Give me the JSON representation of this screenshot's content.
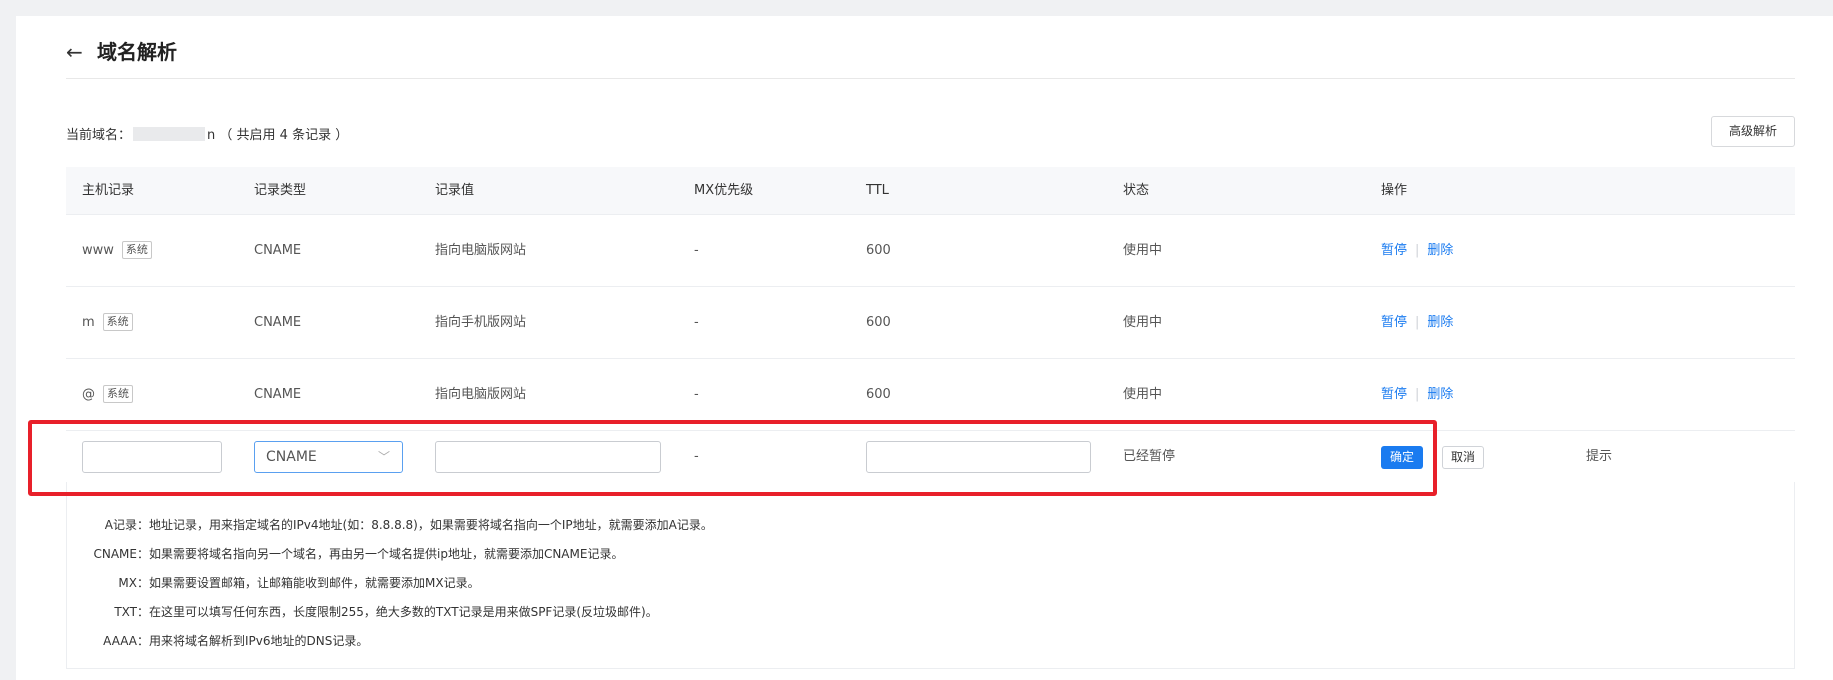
{
  "page": {
    "title": "域名解析",
    "back_icon": "←"
  },
  "domain": {
    "prefix": "当前域名：",
    "mid": "n",
    "suffix": "（ 共启用 4 条记录 ）"
  },
  "advanced_button": "高级解析",
  "columns": [
    "主机记录",
    "记录类型",
    "记录值",
    "MX优先级",
    "TTL",
    "状态",
    "操作"
  ],
  "rows": [
    {
      "host": "www",
      "tag": "系统",
      "type": "CNAME",
      "value": "指向电脑版网站",
      "mx": "-",
      "ttl": "600",
      "status": "使用中",
      "action1": "暂停",
      "action2": "删除"
    },
    {
      "host": "m",
      "tag": "系统",
      "type": "CNAME",
      "value": "指向手机版网站",
      "mx": "-",
      "ttl": "600",
      "status": "使用中",
      "action1": "暂停",
      "action2": "删除"
    },
    {
      "host": "@",
      "tag": "系统",
      "type": "CNAME",
      "value": "指向电脑版网站",
      "mx": "-",
      "ttl": "600",
      "status": "使用中",
      "action1": "暂停",
      "action2": "删除"
    }
  ],
  "separator": "|",
  "edit_row": {
    "type_selected": "CNAME",
    "mx": "-",
    "status": "已经暂停",
    "confirm": "确定",
    "cancel": "取消",
    "hint": "提示"
  },
  "help": [
    {
      "key": "A记录：",
      "text": "地址记录，用来指定域名的IPv4地址(如：8.8.8.8)，如果需要将域名指向一个IP地址，就需要添加A记录。"
    },
    {
      "key": "CNAME：",
      "text": "如果需要将域名指向另一个域名，再由另一个域名提供ip地址，就需要添加CNAME记录。"
    },
    {
      "key": "MX：",
      "text": "如果需要设置邮箱，让邮箱能收到邮件，就需要添加MX记录。"
    },
    {
      "key": "TXT：",
      "text": "在这里可以填写任何东西，长度限制255，绝大多数的TXT记录是用来做SPF记录(反垃圾邮件)。"
    },
    {
      "key": "AAAA：",
      "text": "用来将域名解析到IPv6地址的DNS记录。"
    }
  ],
  "colors": {
    "link": "#1a7bf0",
    "highlight": "#e8202a"
  }
}
